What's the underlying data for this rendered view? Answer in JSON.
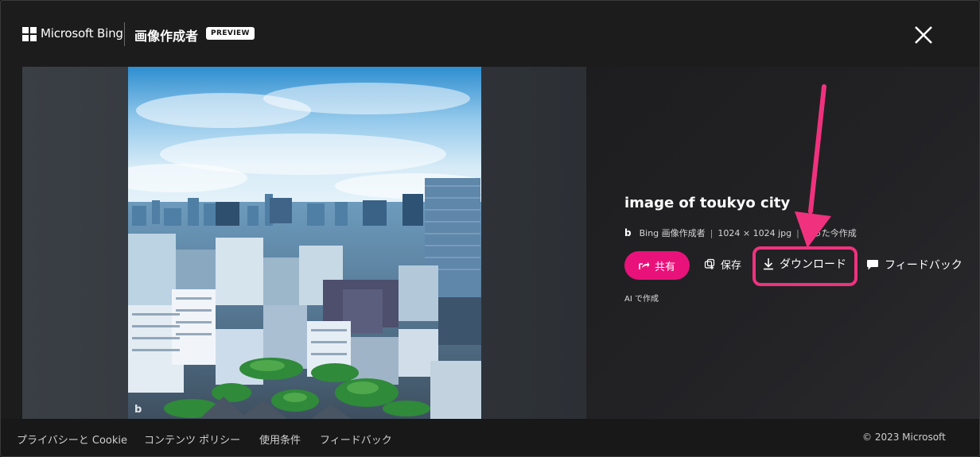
{
  "header": {
    "brand": "Microsoft Bing",
    "app_title": "画像作成者",
    "badge": "PREVIEW"
  },
  "image": {
    "watermark": "b",
    "title": "image of toukyo city",
    "source": "Bing 画像作成者",
    "size": "1024 × 1024 jpg",
    "created": "たった今作成",
    "ai_note": "AI で作成"
  },
  "actions": {
    "share": "共有",
    "save": "保存",
    "download": "ダウンロード",
    "feedback": "フィードバック"
  },
  "footer": {
    "privacy": "プライバシーと Cookie",
    "content_policy": "コンテンツ ポリシー",
    "terms": "使用条件",
    "feedback": "フィードバック",
    "copyright": "© 2023 Microsoft"
  },
  "colors": {
    "accent": "#e8127a",
    "annotation": "#f0327e"
  },
  "icons": [
    "microsoft-logo-icon",
    "close-icon",
    "share-icon",
    "save-collection-icon",
    "download-icon",
    "feedback-icon",
    "bing-icon"
  ]
}
